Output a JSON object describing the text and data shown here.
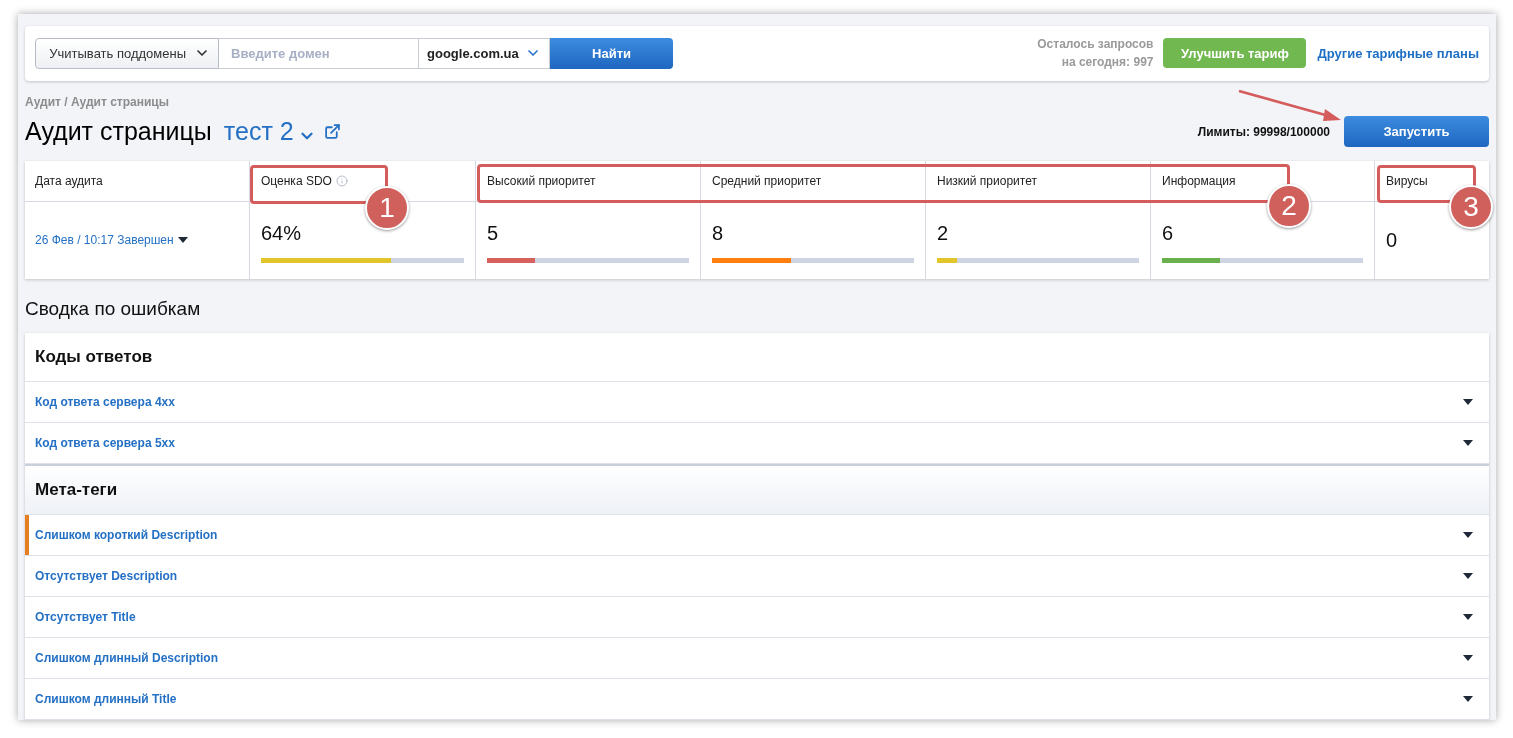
{
  "toolbar": {
    "subdomain_select": "Учитывать поддомены",
    "domain_field": {
      "placeholder": "Введите домен"
    },
    "region_select": "google.com.ua",
    "search_button": "Найти",
    "requests_left": [
      "Осталось запросов",
      "на сегодня: 997"
    ],
    "upgrade_button": "Улучшить тариф",
    "plans_link": "Другие тарифные планы"
  },
  "breadcrumb": "Аудит / Аудит страницы",
  "page_title": "Аудит страницы",
  "project_name": "тест 2",
  "limits": "Лимиты: 99998/100000",
  "run_button": "Запустить",
  "date_column": {
    "heading": "Дата аудита",
    "value": "26 Фев / 10:17 Завершен"
  },
  "metrics": [
    {
      "heading": "Оценка SDO",
      "info": true,
      "value": "64%",
      "level": 0.64,
      "color": "#e2c52b"
    },
    {
      "heading": "Высокий приоритет",
      "info": false,
      "value": "5",
      "level": 0.24,
      "color": "#d6605c"
    },
    {
      "heading": "Средний приоритет",
      "info": false,
      "value": "8",
      "level": 0.39,
      "color": "#ff7f0e"
    },
    {
      "heading": "Низкий приоритет",
      "info": false,
      "value": "2",
      "level": 0.1,
      "color": "#e2c52b"
    },
    {
      "heading": "Информация",
      "info": false,
      "value": "6",
      "level": 0.29,
      "color": "#6ab04c"
    },
    {
      "heading": "Вирусы",
      "info": false,
      "value": "0"
    }
  ],
  "summary_title": "Сводка по ошибкам",
  "groups": [
    {
      "title": "Коды ответов",
      "items": [
        {
          "label": "Код ответа сервера 4xx"
        },
        {
          "label": "Код ответа сервера 5xx"
        }
      ]
    },
    {
      "title": "Мета-теги",
      "items": [
        {
          "label": "Слишком короткий Description",
          "color": "#e67e22"
        },
        {
          "label": "Отсутствует Description"
        },
        {
          "label": "Отсутствует Title"
        },
        {
          "label": "Слишком длинный Description"
        },
        {
          "label": "Слишком длинный Title"
        }
      ]
    }
  ],
  "annotations": [
    {
      "label": "1"
    },
    {
      "label": "2"
    },
    {
      "label": "3"
    }
  ]
}
